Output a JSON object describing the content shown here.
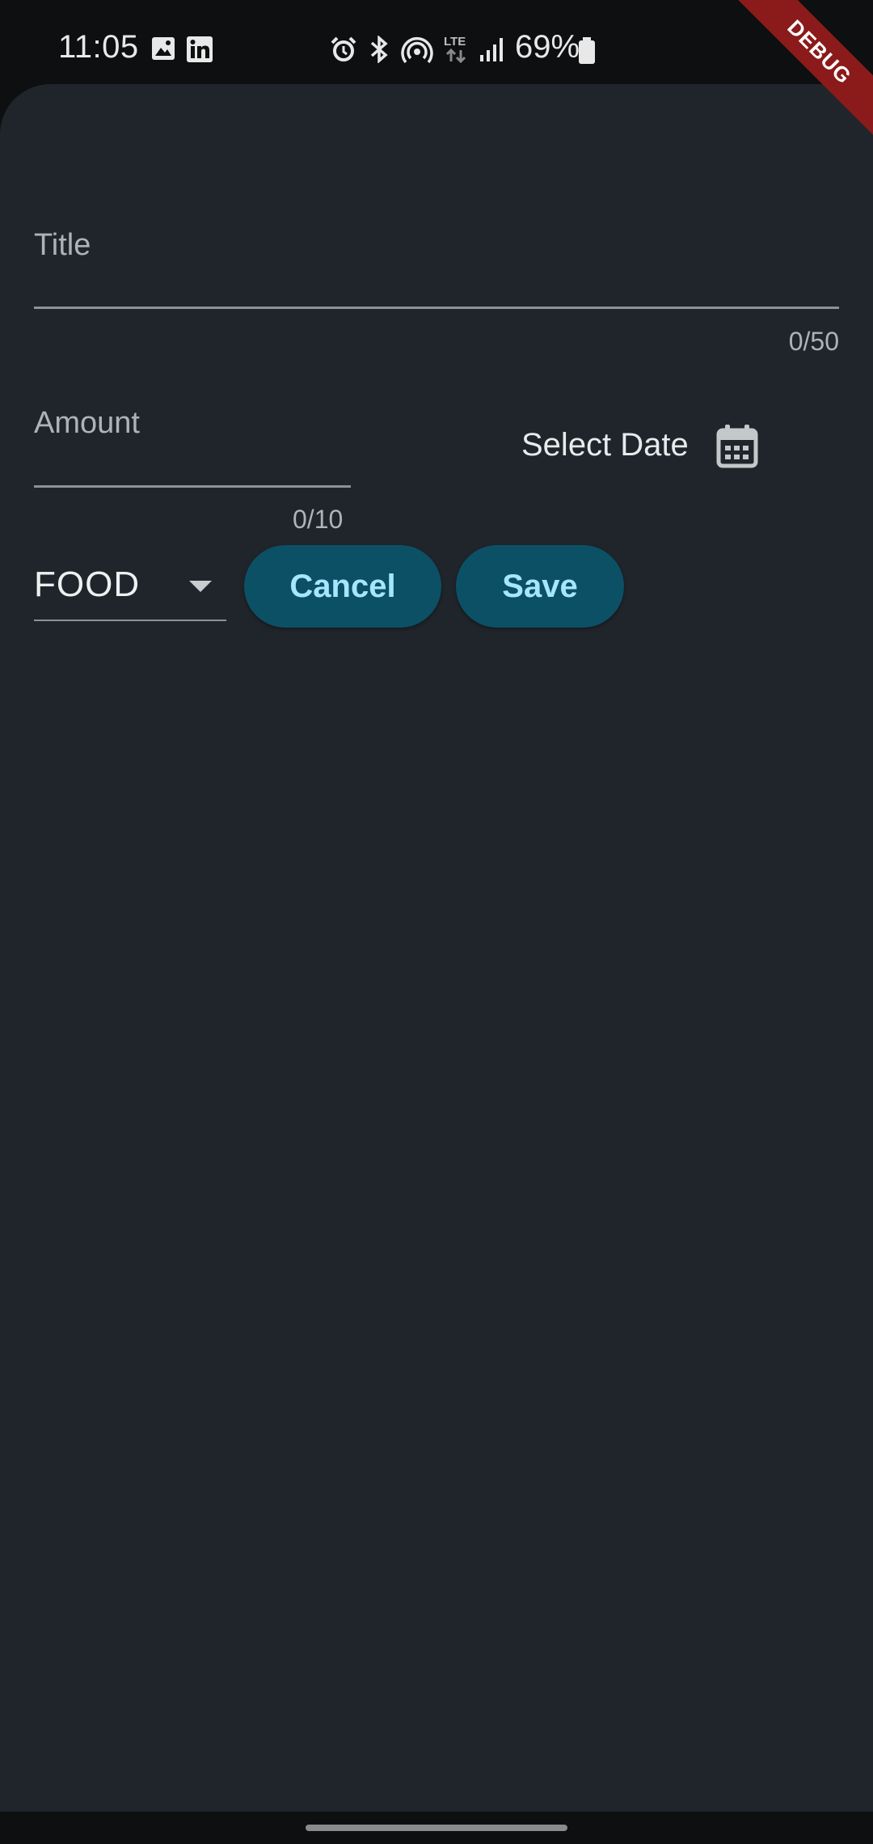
{
  "status_bar": {
    "time": "11:05",
    "battery": "69%",
    "icons": [
      "image-icon",
      "linkedin-icon",
      "alarm-icon",
      "bluetooth-icon",
      "hotspot-icon",
      "lte-icon",
      "signal-icon",
      "battery-icon"
    ],
    "network": "LTE"
  },
  "debug_banner": "DEBUG",
  "form": {
    "title": {
      "label": "Title",
      "counter": "0/50"
    },
    "amount": {
      "label": "Amount",
      "counter": "0/10"
    },
    "date": {
      "label": "Select Date",
      "icon": "calendar-icon"
    },
    "category": {
      "selected": "FOOD"
    },
    "buttons": {
      "cancel": "Cancel",
      "save": "Save"
    }
  },
  "colors": {
    "background": "#1f252b",
    "button_bg": "#0c5066",
    "button_text": "#a6e6ff",
    "debug_banner": "#8b1a1a"
  }
}
